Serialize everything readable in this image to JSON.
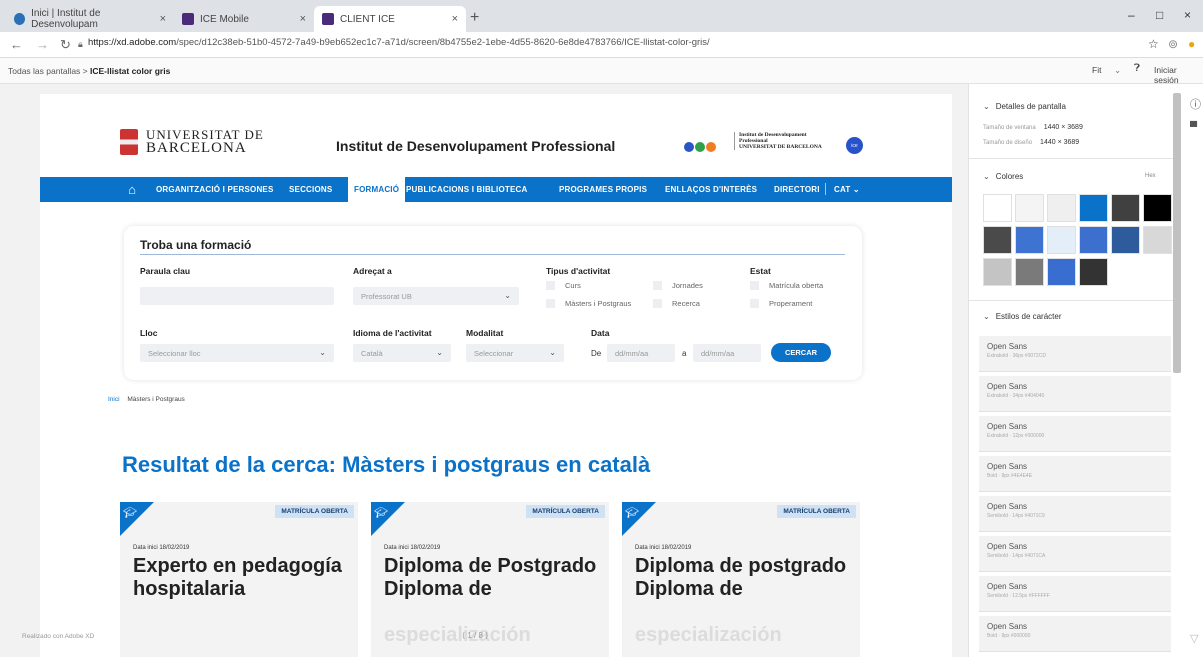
{
  "browser": {
    "tabs": [
      {
        "label": "Inici | Institut de Desenvolupam",
        "close": "×"
      },
      {
        "label": "ICE Mobile",
        "close": "×"
      },
      {
        "label": "CLIENT ICE",
        "close": "×"
      }
    ],
    "new_tab": "+",
    "url_host": "https://xd.adobe.com",
    "url_path": "/spec/d12c38eb-51b0-4572-7a49-b9eb652ec1c7-a71d/screen/8b4755e2-1ebe-4d55-8620-6e8de4783766/ICE-llistat-color-gris/",
    "win_min": "–",
    "win_max": "□",
    "win_close": "×"
  },
  "xd": {
    "breadcrumb_root": "Todas las pantallas",
    "breadcrumb_sep": ">",
    "breadcrumb_current": "ICE-llistat color gris",
    "fit": "Fit",
    "signin": "Iniciar sesión",
    "made_with": "Realizado con Adobe XD",
    "pager": "⟨  1 / 8  ⟩"
  },
  "site": {
    "ub_line1": "UNIVERSITAT DE",
    "ub_line2": "BARCELONA",
    "title": "Institut de Desenvolupament Professional",
    "idp_logo": [
      "Institut de Desenvolupament",
      "Professional",
      "UNIVERSITAT DE BARCELONA"
    ],
    "ice_badge": "ice",
    "nav": [
      "ORGANITZACIÓ I PERSONES",
      "SECCIONS",
      "FORMACIÓ",
      "PUBLICACIONS I BIBLIOTECA",
      "PROGRAMES PROPIS",
      "ENLLAÇOS D'INTERÈS",
      "DIRECTORI",
      "CAT ⌄"
    ],
    "search": {
      "title": "Troba una formació",
      "keyword_label": "Paraula clau",
      "adrecat_label": "Adreçat a",
      "adrecat_value": "Professorat UB",
      "tipus_label": "Tipus d'activitat",
      "tipus_options": [
        "Curs",
        "Jornades",
        "Màsters i Postgraus",
        "Recerca"
      ],
      "estat_label": "Estat",
      "estat_options": [
        "Matrícula oberta",
        "Properament"
      ],
      "lloc_label": "Lloc",
      "lloc_placeholder": "Seleccionar lloc",
      "idioma_label": "Idioma de l'activitat",
      "idioma_value": "Català",
      "modalitat_label": "Modalitat",
      "modalitat_placeholder": "Seleccionar",
      "data_label": "Data",
      "de": "De",
      "a": "a",
      "date_placeholder": "dd/mm/aa",
      "button": "CERCAR"
    },
    "breadcrumb_home": "Inici",
    "breadcrumb_current": "Màsters i Postgraus",
    "results_title": "Resultat de la cerca: Màsters i postgraus en català",
    "cards": [
      {
        "badge": "MATRÍCULA OBERTA",
        "date": "Data inici 18/02/2019",
        "title": "Experto en pedagogía hospitalaria",
        "fade": ""
      },
      {
        "badge": "MATRÍCULA OBERTA",
        "date": "Data inici 18/02/2019",
        "title": "Diploma de Postgrado Diploma de",
        "fade": "especialización"
      },
      {
        "badge": "MATRÍCULA OBERTA",
        "date": "Data inici 18/02/2019",
        "title": "Diploma de postgrado Diploma de",
        "fade": "especialización"
      }
    ]
  },
  "panel": {
    "details_title": "Detalles de pantalla",
    "window_label": "Tamaño de ventana",
    "window_value": "1440 × 3689",
    "design_label": "Tamaño de diseño",
    "design_value": "1440 × 3689",
    "colors_title": "Colores",
    "colors_mode": "Hex",
    "colors": [
      "#ffffff",
      "#f4f4f4",
      "#efefef",
      "#0b72c9",
      "#404040",
      "#000000",
      "#4a4a4a",
      "#3e73d1",
      "#e3eef8",
      "#3d6fcf",
      "#2d5b9c",
      "#d8d8d8",
      "#c4c4c4",
      "#7a7a7a",
      "#3a6dd0",
      "#333333"
    ],
    "char_title": "Estilos de carácter",
    "char_styles": [
      {
        "name": "Open Sans",
        "desc": "Extrabold · 36px #0072CD"
      },
      {
        "name": "Open Sans",
        "desc": "Extrabold · 34px #404040"
      },
      {
        "name": "Open Sans",
        "desc": "Extrabold · 12px #000000"
      },
      {
        "name": "Open Sans",
        "desc": "Bold · 9px #4E4E4E"
      },
      {
        "name": "Open Sans",
        "desc": "Semibold · 14px #4071C9"
      },
      {
        "name": "Open Sans",
        "desc": "Semibold · 14px #4071CA"
      },
      {
        "name": "Open Sans",
        "desc": "Semibold · 12.5px #FFFFFF"
      },
      {
        "name": "Open Sans",
        "desc": "Bold · 9px #000000"
      }
    ]
  }
}
